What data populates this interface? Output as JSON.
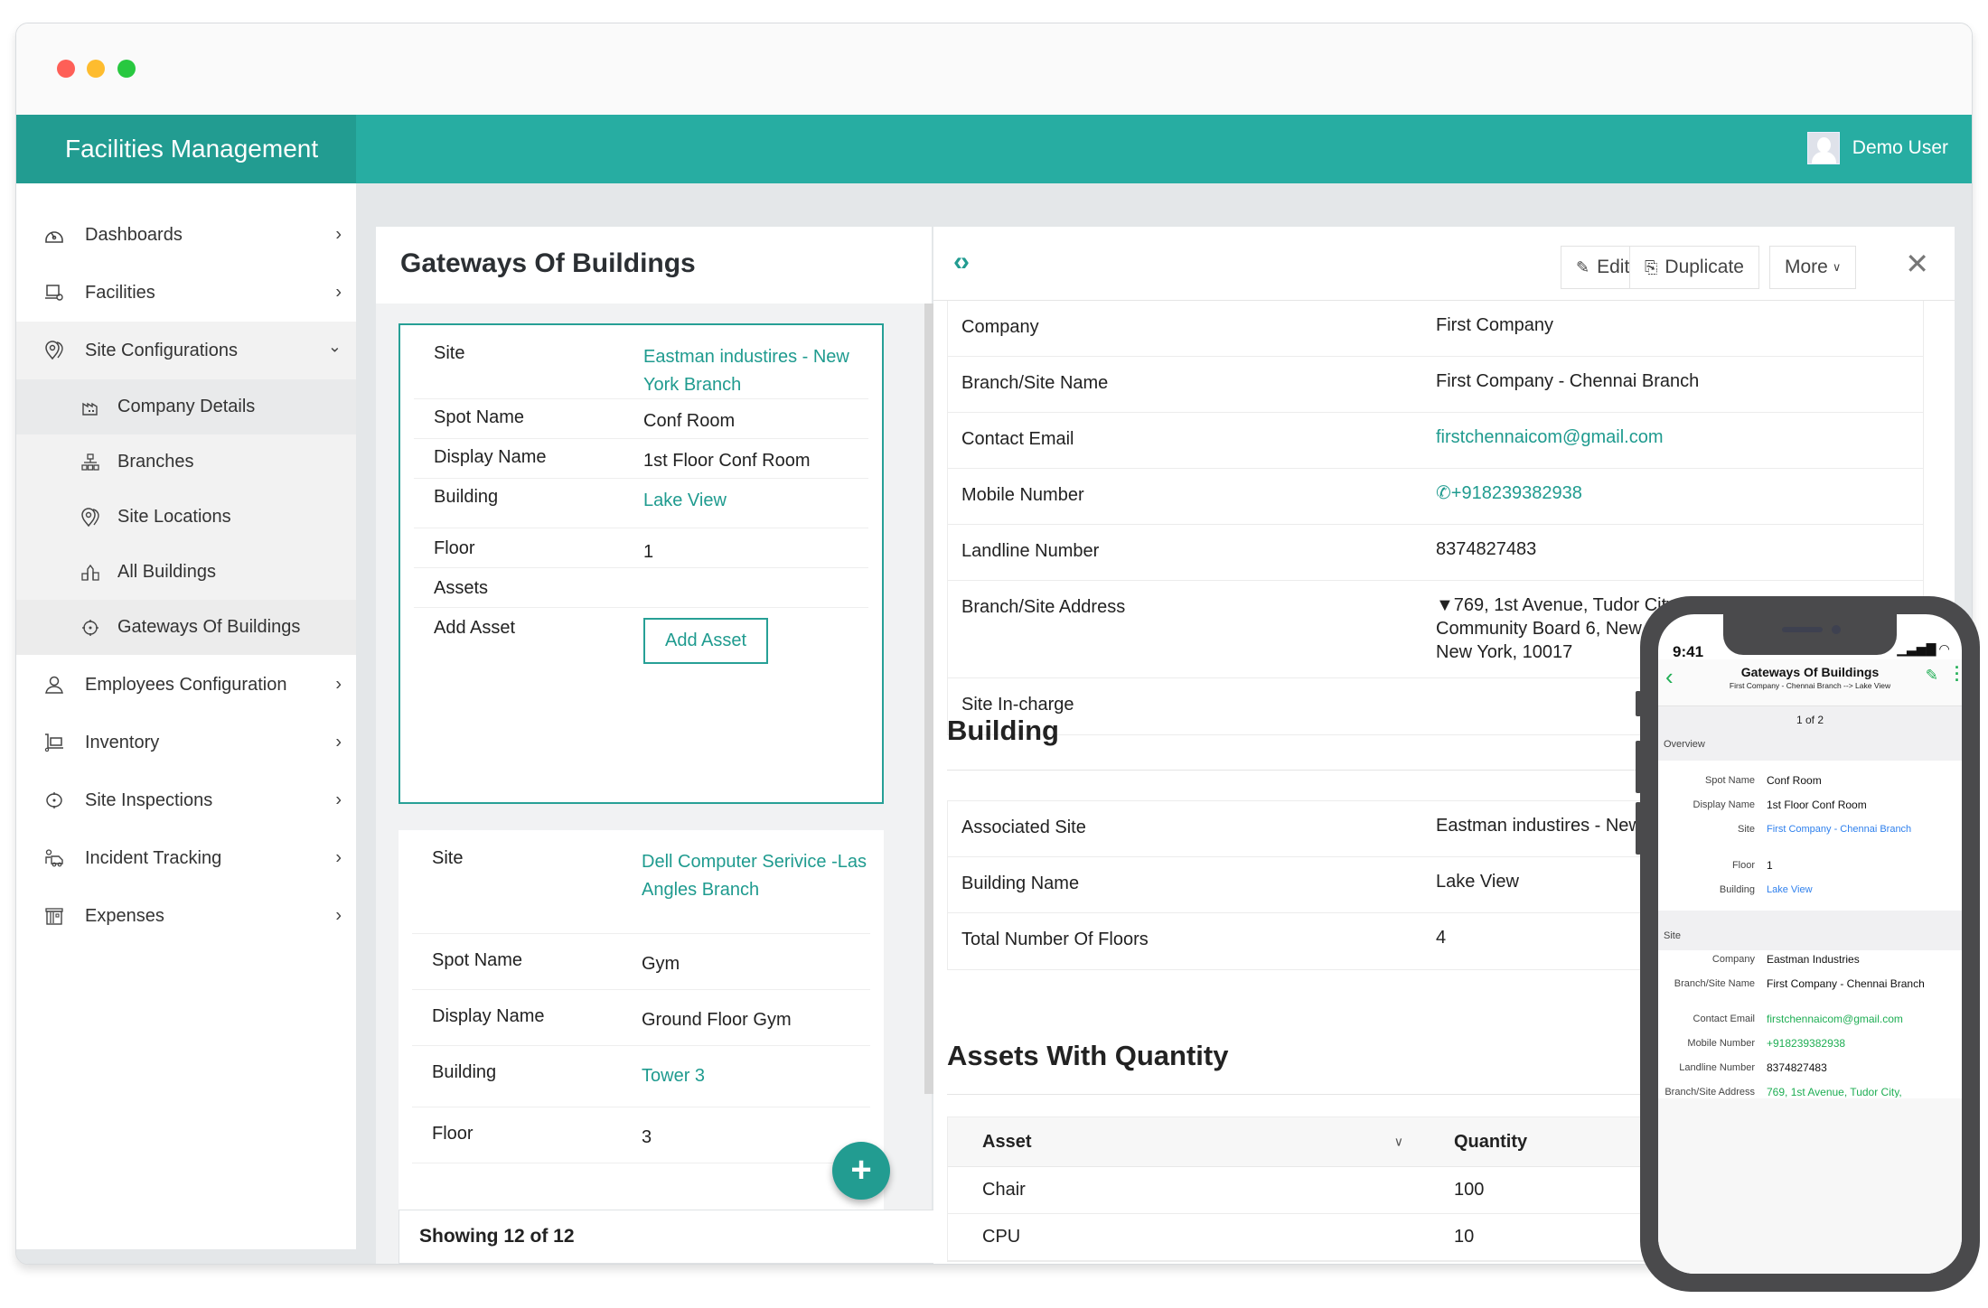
{
  "window": {
    "traffic_lights": [
      "close",
      "minimize",
      "maximize"
    ]
  },
  "appbar": {
    "brand": "Facilities Management",
    "user_name": "Demo User",
    "brand_color": "#229c91",
    "accent_color": "#27ada2"
  },
  "sidebar": {
    "items": [
      {
        "label": "Dashboards",
        "icon": "dashboard-gauge-icon",
        "chevron": "›"
      },
      {
        "label": "Facilities",
        "icon": "facilities-laptop-gear-icon",
        "chevron": "›"
      },
      {
        "label": "Site Configurations",
        "icon": "map-pin-icon",
        "chevron": "⌄"
      },
      {
        "label": "Company Details",
        "icon": "factory-icon"
      },
      {
        "label": "Branches",
        "icon": "org-chart-icon"
      },
      {
        "label": "Site Locations",
        "icon": "map-pin-icon"
      },
      {
        "label": "All Buildings",
        "icon": "buildings-icon"
      },
      {
        "label": "Gateways Of Buildings",
        "icon": "crosshair-icon"
      },
      {
        "label": "Employees Configuration",
        "icon": "user-icon",
        "chevron": "›"
      },
      {
        "label": "Inventory",
        "icon": "trolley-icon",
        "chevron": "›"
      },
      {
        "label": "Site Inspections",
        "icon": "crosshair-icon",
        "chevron": "›"
      },
      {
        "label": "Incident Tracking",
        "icon": "ambulance-icon",
        "chevron": "›"
      },
      {
        "label": "Expenses",
        "icon": "cash-register-icon",
        "chevron": "›"
      }
    ]
  },
  "list": {
    "title": "Gateways Of Buildings",
    "cards": [
      {
        "site_label": "Site",
        "site": "Eastman industires - New York Branch",
        "spot_label": "Spot Name",
        "spot": "Conf Room",
        "display_label": "Display Name",
        "display": "1st Floor Conf Room",
        "building_label": "Building",
        "building": "Lake View",
        "floor_label": "Floor",
        "floor": "1",
        "assets_label": "Assets",
        "assets": "",
        "add_asset_label": "Add Asset",
        "add_asset_button": "Add Asset"
      },
      {
        "site_label": "Site",
        "site": "Dell Computer Serivice -Las Angles Branch",
        "spot_label": "Spot Name",
        "spot": "Gym",
        "display_label": "Display Name",
        "display": "Ground Floor Gym",
        "building_label": "Building",
        "building": "Tower 3",
        "floor_label": "Floor",
        "floor": "3"
      }
    ],
    "fab_label": "+",
    "footer": "Showing 12 of 12"
  },
  "detail": {
    "toolbar": {
      "edit": "Edit",
      "duplicate": "Duplicate",
      "more": "More",
      "close": "✕"
    },
    "site_fields": [
      {
        "label": "Company",
        "value": "First Company"
      },
      {
        "label": "Branch/Site Name",
        "value": "First Company - Chennai Branch"
      },
      {
        "label": "Contact Email",
        "value": "firstchennaicom@gmail.com"
      },
      {
        "label": "Mobile Number",
        "value": "+918239382938"
      },
      {
        "label": "Landline Number",
        "value": "8374827483"
      },
      {
        "label": "Branch/Site Address",
        "value": "769, 1st Avenue, Tudor City, Manhattan, Manhattan Community Board 6, New York County, New York City, New York, 10017"
      },
      {
        "label": "Site In-charge",
        "value": ""
      }
    ],
    "building_section": {
      "title": "Building",
      "fields": [
        {
          "label": "Associated Site",
          "value": "Eastman industires - New York Branch"
        },
        {
          "label": "Building Name",
          "value": "Lake View"
        },
        {
          "label": "Total Number Of Floors",
          "value": "4"
        }
      ]
    },
    "assets_section": {
      "title": "Assets With Quantity",
      "columns": [
        "Asset",
        "Quantity"
      ],
      "rows": [
        {
          "asset": "Chair",
          "quantity": "100"
        },
        {
          "asset": "CPU",
          "quantity": "10"
        }
      ]
    }
  },
  "phone": {
    "time": "9:41",
    "title": "Gateways Of Buildings",
    "subtitle": "First Company - Chennai Branch --> Lake View",
    "pager": "1 of 2",
    "overview_label": "Overview",
    "overview": [
      {
        "label": "Spot Name",
        "value": "Conf Room"
      },
      {
        "label": "Display Name",
        "value": "1st Floor Conf Room"
      },
      {
        "label": "Site",
        "value": "First Company - Chennai Branch"
      },
      {
        "label": "Floor",
        "value": "1"
      },
      {
        "label": "Building",
        "value": "Lake View"
      }
    ],
    "site_label": "Site",
    "site": [
      {
        "label": "Company",
        "value": "Eastman Industries"
      },
      {
        "label": "Branch/Site Name",
        "value": "First Company - Chennai Branch"
      },
      {
        "label": "Contact Email",
        "value": "firstchennaicom@gmail.com"
      },
      {
        "label": "Mobile Number",
        "value": "+918239382938"
      },
      {
        "label": "Landline Number",
        "value": "8374827483"
      },
      {
        "label": "Branch/Site Address",
        "value": "769, 1st Avenue, Tudor City,"
      }
    ]
  }
}
